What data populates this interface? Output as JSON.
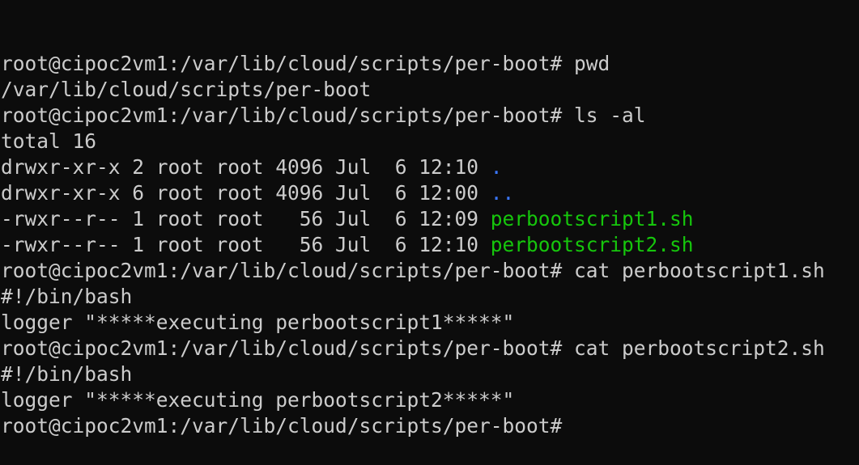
{
  "colors": {
    "background": "#0c0c0c",
    "text": "#cccccc",
    "directory": "#3b78ff",
    "executable": "#16c60c"
  },
  "terminal": {
    "lines": [
      {
        "type": "command",
        "prompt": "root@cipoc2vm1:/var/lib/cloud/scripts/per-boot#",
        "command": " pwd"
      },
      {
        "type": "output",
        "text": "/var/lib/cloud/scripts/per-boot"
      },
      {
        "type": "command",
        "prompt": "root@cipoc2vm1:/var/lib/cloud/scripts/per-boot#",
        "command": " ls -al"
      },
      {
        "type": "output",
        "text": "total 16"
      },
      {
        "type": "listing",
        "meta": "drwxr-xr-x 2 root root 4096 Jul  6 12:10 ",
        "name": ".",
        "kind": "directory"
      },
      {
        "type": "listing",
        "meta": "drwxr-xr-x 6 root root 4096 Jul  6 12:00 ",
        "name": "..",
        "kind": "directory"
      },
      {
        "type": "listing",
        "meta": "-rwxr--r-- 1 root root   56 Jul  6 12:09 ",
        "name": "perbootscript1.sh",
        "kind": "executable"
      },
      {
        "type": "listing",
        "meta": "-rwxr--r-- 1 root root   56 Jul  6 12:10 ",
        "name": "perbootscript2.sh",
        "kind": "executable"
      },
      {
        "type": "command",
        "prompt": "root@cipoc2vm1:/var/lib/cloud/scripts/per-boot#",
        "command": " cat perbootscript1.sh"
      },
      {
        "type": "output",
        "text": "#!/bin/bash"
      },
      {
        "type": "output",
        "text": "logger \"*****executing perbootscript1*****\""
      },
      {
        "type": "command",
        "prompt": "root@cipoc2vm1:/var/lib/cloud/scripts/per-boot#",
        "command": " cat perbootscript2.sh"
      },
      {
        "type": "output",
        "text": "#!/bin/bash"
      },
      {
        "type": "output",
        "text": "logger \"*****executing perbootscript2*****\""
      },
      {
        "type": "command",
        "prompt": "root@cipoc2vm1:/var/lib/cloud/scripts/per-boot#",
        "command": ""
      }
    ]
  }
}
